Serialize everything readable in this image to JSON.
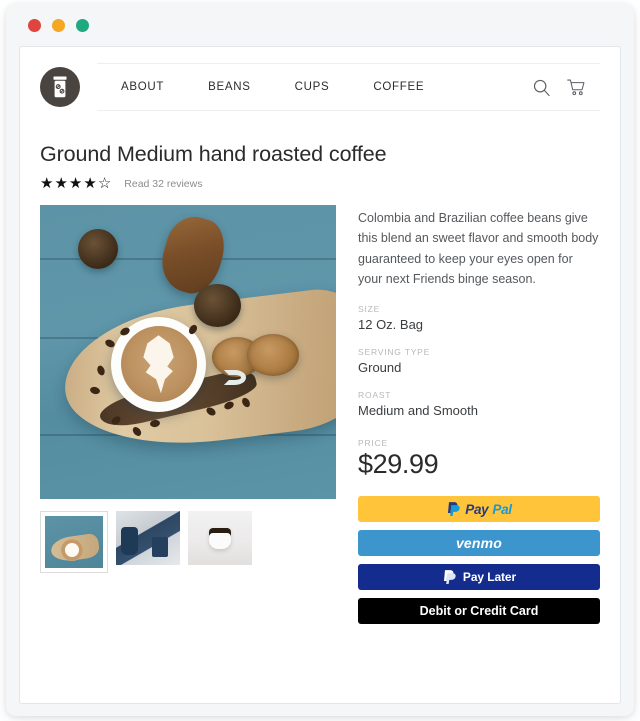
{
  "window": {
    "traffic_lights": [
      {
        "name": "close",
        "color": "#e0443e"
      },
      {
        "name": "minimize",
        "color": "#f5a623"
      },
      {
        "name": "zoom",
        "color": "#1fa97f"
      }
    ]
  },
  "header": {
    "logo_icon": "coffee-jar-icon",
    "nav_items": [
      {
        "label": "ABOUT"
      },
      {
        "label": "BEANS"
      },
      {
        "label": "CUPS"
      },
      {
        "label": "COFFEE"
      }
    ],
    "icons": [
      {
        "name": "search-icon"
      },
      {
        "name": "cart-icon"
      }
    ]
  },
  "product": {
    "title": "Ground Medium hand roasted coffee",
    "rating": {
      "value": 4,
      "max": 5,
      "filled_glyph": "★",
      "empty_glyph": "☆"
    },
    "reviews_text": "Read 32 reviews",
    "description": "Colombia and Brazilian coffee beans give this blend an sweet flavor and smooth body guaranteed to keep your eyes open for your next Friends binge season.",
    "specs": [
      {
        "label": "SIZE",
        "value": "12 Oz. Bag"
      },
      {
        "label": "SERVING TYPE",
        "value": "Ground"
      },
      {
        "label": "ROAST",
        "value": "Medium and Smooth"
      }
    ],
    "price": {
      "label": "PRICE",
      "value": "$29.99"
    },
    "gallery": {
      "main_alt": "Latte with leaf art on wooden board with cookies, croissant, pine cones and coffee beans on teal wood table",
      "thumbnails": [
        {
          "alt": "Latte on wooden board flat lay",
          "selected": true
        },
        {
          "alt": "Blue ceramic pitcher and cups kitchen scene",
          "selected": false
        },
        {
          "alt": "White cup of black coffee with scattered beans",
          "selected": false
        }
      ]
    }
  },
  "payment": {
    "buttons": [
      {
        "name": "paypal",
        "text_part1": "Pay",
        "text_part2": "Pal",
        "bg": "#ffc439"
      },
      {
        "name": "venmo",
        "label": "venmo",
        "bg": "#3d95ce"
      },
      {
        "name": "paylater",
        "label": "Pay Later",
        "bg": "#142c8e"
      },
      {
        "name": "debit-credit-card",
        "label": "Debit or Credit Card",
        "bg": "#000000"
      }
    ]
  }
}
